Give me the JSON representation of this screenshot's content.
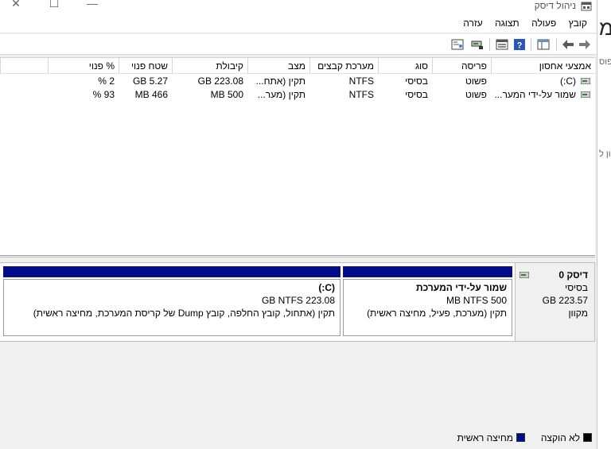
{
  "window": {
    "title": "ניהול דיסק"
  },
  "menu": [
    "קובץ",
    "פעולה",
    "תצוגה",
    "עזרה"
  ],
  "columns": [
    "אמצעי אחסון",
    "פריסה",
    "סוג",
    "מערכת קבצים",
    "מצב",
    "קיבולת",
    "שטח פנוי",
    "% פנוי"
  ],
  "volumes": [
    {
      "name": "(C:)",
      "layout": "פשוט",
      "type": "בסיסי",
      "fs": "NTFS",
      "status": "תקין (אתח...",
      "capacity": "223.08 GB",
      "free": "5.27 GB",
      "pct": "2 %"
    },
    {
      "name": "שמור על-ידי המער...",
      "layout": "פשוט",
      "type": "בסיסי",
      "fs": "NTFS",
      "status": "תקין (מער...",
      "capacity": "500 MB",
      "free": "466 MB",
      "pct": "93 %"
    }
  ],
  "disk": {
    "name": "דיסק 0",
    "type": "בסיסי",
    "size": "223.57 GB",
    "state": "מקוון"
  },
  "partitions": [
    {
      "name": "שמור על-ידי המערכת",
      "size": "500 MB NTFS",
      "status": "תקין (מערכת, פעיל, מחיצה ראשית)"
    },
    {
      "name": "(C:)",
      "size": "223.08 GB NTFS",
      "status": "תקין (אתחול, קובץ החלפה, קובץ Dump של קריסת המערכת, מחיצה ראשית)"
    }
  ],
  "legend": [
    "לא הוקצה",
    "מחיצה ראשית"
  ],
  "side_panel": {
    "big": "מ",
    "line1": "פוס",
    "line2": "ון ל"
  },
  "colors": {
    "primary_partition": "#000c8c",
    "unallocated": "#000000"
  },
  "icons": [
    "back-arrow-icon",
    "forward-arrow-icon",
    "console-tree-icon",
    "help-icon",
    "properties-icon",
    "disk-icon",
    "settings-icon"
  ]
}
